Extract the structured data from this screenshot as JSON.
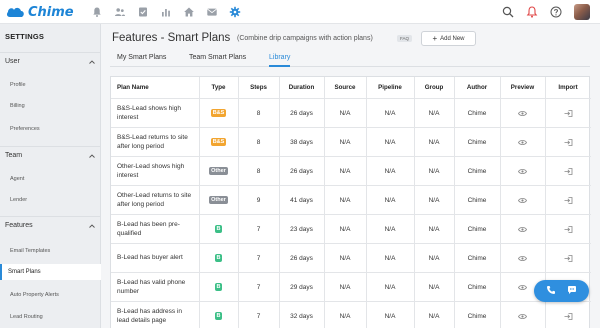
{
  "app": {
    "name": "Chime",
    "accent": "#2a8ad8"
  },
  "topnav": {
    "icons": [
      "bell-icon",
      "users-icon",
      "tasks-icon",
      "chart-icon",
      "home-icon",
      "email-icon",
      "gear-icon"
    ],
    "right_icons": [
      "search-icon",
      "notification-icon",
      "help-icon"
    ]
  },
  "sidebar": {
    "heading": "SETTINGS",
    "sections": [
      {
        "label": "User",
        "items": [
          "Profile",
          "Billing",
          "Preferences"
        ]
      },
      {
        "label": "Team",
        "items": [
          "Agent",
          "Lender"
        ]
      },
      {
        "label": "Features",
        "items": [
          "Email Templates",
          "Smart Plans",
          "Auto Property Alerts",
          "Lead Routing"
        ]
      }
    ],
    "active_item": "Smart Plans"
  },
  "page": {
    "title": "Features - Smart Plans",
    "subtitle": "(Combine drip campaigns with action plans)",
    "faq": "FAQ",
    "add_button": "Add New"
  },
  "tabs": [
    "My Smart Plans",
    "Team Smart Plans",
    "Library"
  ],
  "active_tab": "Library",
  "table": {
    "columns": [
      "Plan Name",
      "Type",
      "Steps",
      "Duration",
      "Source",
      "Pipeline",
      "Group",
      "Author",
      "Preview",
      "Import"
    ],
    "rows": [
      {
        "name": "B&S-Lead shows high interest",
        "type": "B&S",
        "steps": "8",
        "duration": "26 days",
        "source": "N/A",
        "pipeline": "N/A",
        "group": "N/A",
        "author": "Chime"
      },
      {
        "name": "B&S-Lead returns to site after long period",
        "type": "B&S",
        "steps": "8",
        "duration": "38 days",
        "source": "N/A",
        "pipeline": "N/A",
        "group": "N/A",
        "author": "Chime"
      },
      {
        "name": "Other-Lead shows high interest",
        "type": "Other",
        "steps": "8",
        "duration": "26 days",
        "source": "N/A",
        "pipeline": "N/A",
        "group": "N/A",
        "author": "Chime"
      },
      {
        "name": "Other-Lead returns to site after long period",
        "type": "Other",
        "steps": "9",
        "duration": "41 days",
        "source": "N/A",
        "pipeline": "N/A",
        "group": "N/A",
        "author": "Chime"
      },
      {
        "name": "B-Lead has been pre-qualified",
        "type": "B",
        "steps": "7",
        "duration": "23 days",
        "source": "N/A",
        "pipeline": "N/A",
        "group": "N/A",
        "author": "Chime"
      },
      {
        "name": "B-Lead has buyer alert",
        "type": "B",
        "steps": "7",
        "duration": "26 days",
        "source": "N/A",
        "pipeline": "N/A",
        "group": "N/A",
        "author": "Chime"
      },
      {
        "name": "B-Lead has valid phone number",
        "type": "B",
        "steps": "7",
        "duration": "29 days",
        "source": "N/A",
        "pipeline": "N/A",
        "group": "N/A",
        "author": "Chime"
      },
      {
        "name": "B-Lead has address in lead details page",
        "type": "B",
        "steps": "7",
        "duration": "32 days",
        "source": "N/A",
        "pipeline": "N/A",
        "group": "N/A",
        "author": "Chime"
      }
    ]
  },
  "badge_colors": {
    "B&S": "#f2a530",
    "Other": "#8a8f96",
    "B": "#3cbf87"
  },
  "fab_icons": [
    "phone-icon",
    "chat-icon"
  ]
}
